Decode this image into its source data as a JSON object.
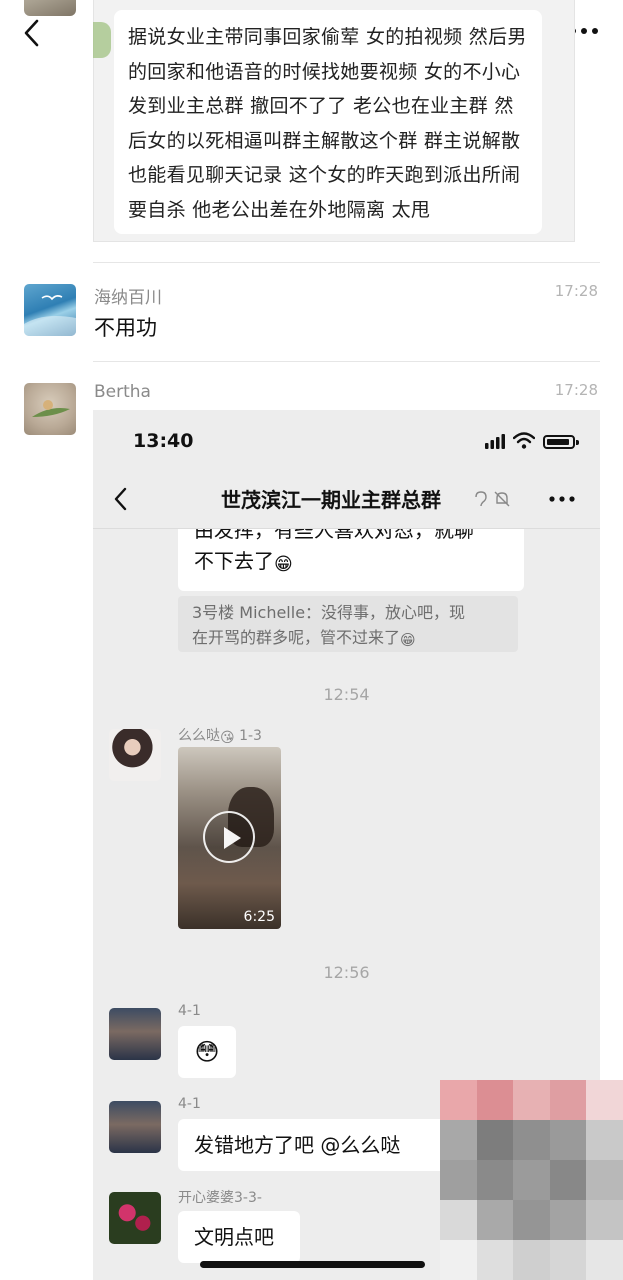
{
  "outer": {
    "post_text": "据说女业主带同事回家偷荤 女的拍视频 然后男的回家和他语音的时候找她要视频 女的不小心发到业主总群 撤回不了了 老公也在业主群 然后女的以死相逼叫群主解散这个群 群主说解散也能看见聊天记录 这个女的昨天跑到派出所闹 要自杀 他老公出差在外地隔离 太甩",
    "messages": [
      {
        "name": "海纳百川",
        "time": "17:28",
        "text": "不用功"
      },
      {
        "name": "Bertha",
        "time": "17:28"
      }
    ]
  },
  "screenshot": {
    "status_time": "13:40",
    "title": "世茂滨江一期业主群总群",
    "prev_bubble_line1": "由发挥，有些人喜欢对怼，就聊",
    "prev_bubble_line2": "不下去了",
    "quote_line1": "3号楼 Michelle：没得事，放心吧，现",
    "quote_line2": "在开骂的群多呢，管不过来了",
    "timestamp1": "12:54",
    "sender1": "么么哒",
    "sender1_emoji": "😘",
    "sender1_unit": "1-3",
    "video_duration": "6:25",
    "timestamp2": "12:56",
    "sender2": "4-1",
    "sender2_msg": "😳",
    "sender3": "4-1",
    "sender3_msg": "发错地方了吧 @么么哒",
    "sender4": "开心婆婆3-3-",
    "sender4_msg": "文明点吧"
  },
  "emoji": {
    "grin": "😁",
    "mosaic_colors": [
      "#e9a7aa",
      "#dc8e93",
      "#e7b1b3",
      "#df9ea2",
      "#f1d6d7",
      "#a8a8a8",
      "#7d7d7d",
      "#8f8f8f",
      "#9a9a9a",
      "#c9c9c9",
      "#9f9f9f",
      "#8a8a8a",
      "#9b9b9b",
      "#888888",
      "#b8b8b8",
      "#d9d9d9",
      "#a9a9a9",
      "#959595",
      "#a3a3a3",
      "#c4c4c4",
      "#f0f0f0",
      "#dedede",
      "#cfcfcf",
      "#d6d6d6",
      "#e6e6e6"
    ]
  }
}
